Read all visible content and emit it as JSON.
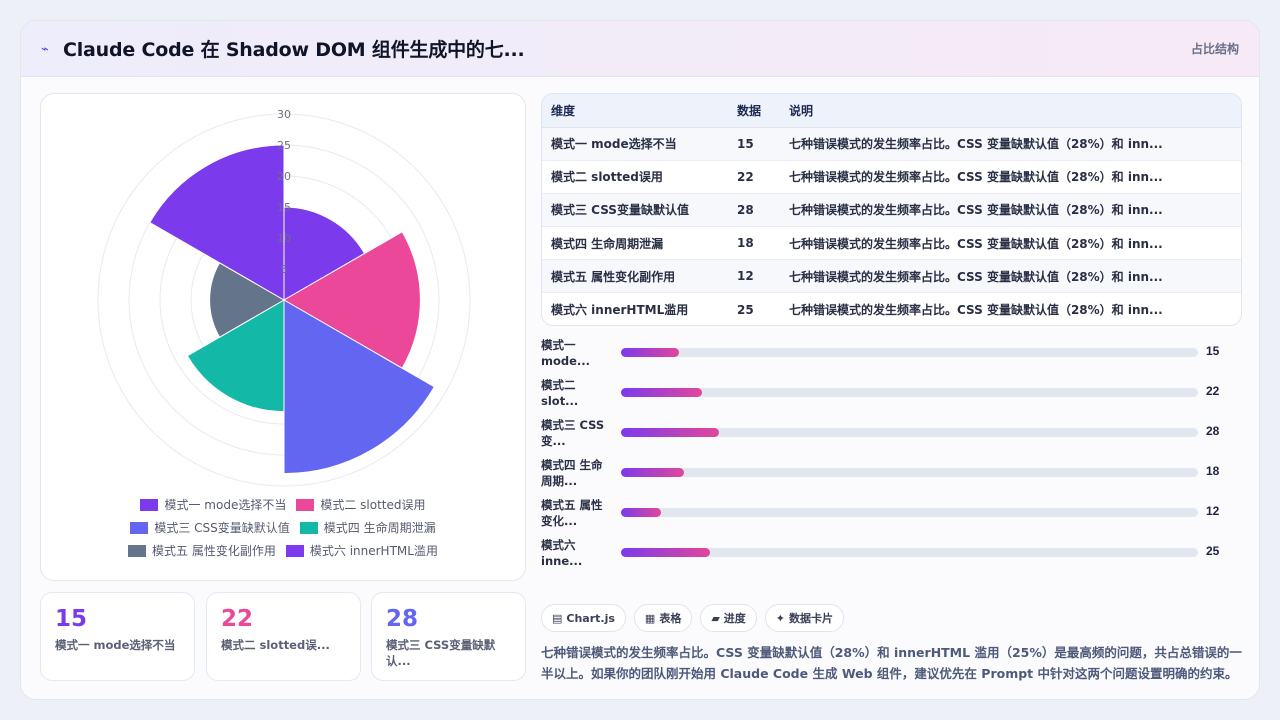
{
  "header": {
    "icon": "sparkle-icon",
    "title": "Claude Code 在 Shadow DOM 组件生成中的七...",
    "tag": "占比结构"
  },
  "chart_data": {
    "type": "polarArea",
    "categories": [
      "模式一 mode选择不当",
      "模式二 slotted误用",
      "模式三 CSS变量缺默认值",
      "模式四 生命周期泄漏",
      "模式五 属性变化副作用",
      "模式六 innerHTML滥用"
    ],
    "values": [
      15,
      22,
      28,
      18,
      12,
      25
    ],
    "colors": [
      "#7c3aed",
      "#ec4899",
      "#6366f1",
      "#14b8a6",
      "#64748b",
      "#7c3aed"
    ],
    "r_ticks": [
      "5",
      "10",
      "15",
      "20",
      "25",
      "30"
    ],
    "rlim": [
      0,
      30
    ],
    "legend_position": "bottom"
  },
  "stats": [
    {
      "value": "15",
      "label": "模式一 mode选择不当",
      "color": "#7c3aed"
    },
    {
      "value": "22",
      "label": "模式二 slotted误...",
      "color": "#ec4899"
    },
    {
      "value": "28",
      "label": "模式三 CSS变量缺默认...",
      "color": "#6366f1"
    }
  ],
  "table": {
    "headers": [
      "维度",
      "数据",
      "说明"
    ],
    "rows": [
      [
        "模式一 mode选择不当",
        "15",
        "七种错误模式的发生频率占比。CSS 变量缺默认值（28%）和 inn..."
      ],
      [
        "模式二 slotted误用",
        "22",
        "七种错误模式的发生频率占比。CSS 变量缺默认值（28%）和 inn..."
      ],
      [
        "模式三 CSS变量缺默认值",
        "28",
        "七种错误模式的发生频率占比。CSS 变量缺默认值（28%）和 inn..."
      ],
      [
        "模式四 生命周期泄漏",
        "18",
        "七种错误模式的发生频率占比。CSS 变量缺默认值（28%）和 inn..."
      ],
      [
        "模式五 属性变化副作用",
        "12",
        "七种错误模式的发生频率占比。CSS 变量缺默认值（28%）和 inn..."
      ],
      [
        "模式六 innerHTML滥用",
        "25",
        "七种错误模式的发生频率占比。CSS 变量缺默认值（28%）和 inn..."
      ]
    ]
  },
  "progress": [
    {
      "label": "模式一 mode...",
      "value": "15",
      "pct": 0.1
    },
    {
      "label": "模式二 slot...",
      "value": "22",
      "pct": 0.14
    },
    {
      "label": "模式三 CSS 变...",
      "value": "28",
      "pct": 0.17
    },
    {
      "label": "模式四 生命周期...",
      "value": "18",
      "pct": 0.11
    },
    {
      "label": "模式五 属性变化...",
      "value": "12",
      "pct": 0.07
    },
    {
      "label": "模式六 inne...",
      "value": "25",
      "pct": 0.155
    }
  ],
  "chips": [
    {
      "icon": "chart-icon",
      "glyph": "▤",
      "label": "Chart.js"
    },
    {
      "icon": "table-icon",
      "glyph": "▦",
      "label": "表格"
    },
    {
      "icon": "progress-icon",
      "glyph": "▰",
      "label": "进度"
    },
    {
      "icon": "card-icon",
      "glyph": "✦",
      "label": "数据卡片"
    }
  ],
  "summary": "七种错误模式的发生频率占比。CSS 变量缺默认值（28%）和 innerHTML 滥用（25%）是最高频的问题，共占总错误的一半以上。如果你的团队刚开始用 Claude Code 生成 Web 组件，建议优先在 Prompt 中针对这两个问题设置明确的约束。"
}
